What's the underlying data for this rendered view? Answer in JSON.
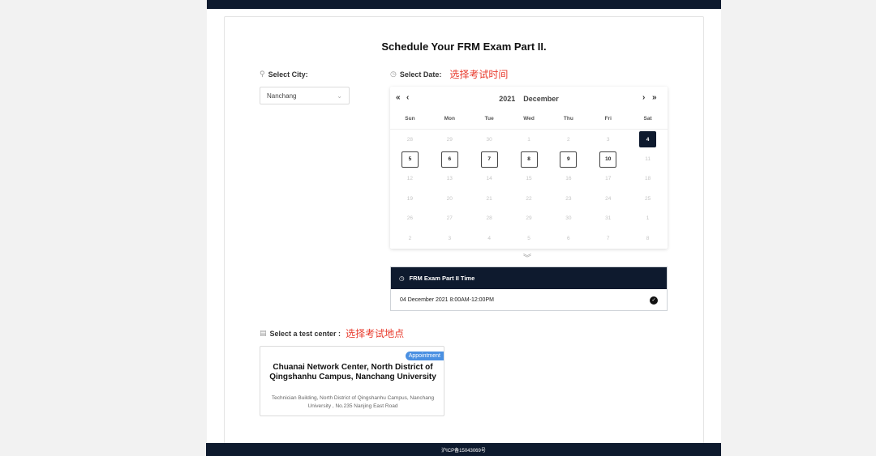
{
  "page": {
    "title": "Schedule Your FRM Exam Part II."
  },
  "city": {
    "label": "Select City:",
    "icon": "location-pin-icon",
    "value": "Nanchang"
  },
  "date": {
    "label": "Select Date:",
    "icon": "clock-icon",
    "annotation": "选择考试时间"
  },
  "calendar": {
    "year": "2021",
    "month": "December",
    "prev_year": "«",
    "prev_month": "‹",
    "next_month": "›",
    "next_year": "»",
    "weekdays": [
      "Sun",
      "Mon",
      "Tue",
      "Wed",
      "Thu",
      "Fri",
      "Sat"
    ],
    "days": [
      {
        "d": "28",
        "s": "muted"
      },
      {
        "d": "29",
        "s": "muted"
      },
      {
        "d": "30",
        "s": "muted"
      },
      {
        "d": "1",
        "s": "muted"
      },
      {
        "d": "2",
        "s": "muted"
      },
      {
        "d": "3",
        "s": "muted"
      },
      {
        "d": "4",
        "s": "selected"
      },
      {
        "d": "5",
        "s": "available"
      },
      {
        "d": "6",
        "s": "available"
      },
      {
        "d": "7",
        "s": "available"
      },
      {
        "d": "8",
        "s": "available"
      },
      {
        "d": "9",
        "s": "available"
      },
      {
        "d": "10",
        "s": "available"
      },
      {
        "d": "11",
        "s": "muted"
      },
      {
        "d": "12",
        "s": "muted"
      },
      {
        "d": "13",
        "s": "muted"
      },
      {
        "d": "14",
        "s": "muted"
      },
      {
        "d": "15",
        "s": "muted"
      },
      {
        "d": "16",
        "s": "muted"
      },
      {
        "d": "17",
        "s": "muted"
      },
      {
        "d": "18",
        "s": "muted"
      },
      {
        "d": "19",
        "s": "muted"
      },
      {
        "d": "20",
        "s": "muted"
      },
      {
        "d": "21",
        "s": "muted"
      },
      {
        "d": "22",
        "s": "muted"
      },
      {
        "d": "23",
        "s": "muted"
      },
      {
        "d": "24",
        "s": "muted"
      },
      {
        "d": "25",
        "s": "muted"
      },
      {
        "d": "26",
        "s": "muted"
      },
      {
        "d": "27",
        "s": "muted"
      },
      {
        "d": "28",
        "s": "muted"
      },
      {
        "d": "29",
        "s": "muted"
      },
      {
        "d": "30",
        "s": "muted"
      },
      {
        "d": "31",
        "s": "muted"
      },
      {
        "d": "1",
        "s": "muted"
      },
      {
        "d": "2",
        "s": "muted"
      },
      {
        "d": "3",
        "s": "muted"
      },
      {
        "d": "4",
        "s": "muted"
      },
      {
        "d": "5",
        "s": "muted"
      },
      {
        "d": "6",
        "s": "muted"
      },
      {
        "d": "7",
        "s": "muted"
      },
      {
        "d": "8",
        "s": "muted"
      }
    ]
  },
  "exam_time": {
    "header": "FRM Exam Part II Time",
    "slot": "04 December 2021 8:00AM-12:00PM",
    "selected": true
  },
  "test_center": {
    "label": "Select a test center :",
    "icon": "document-icon",
    "annotation": "选择考试地点",
    "badge": "Appointment",
    "name": "Chuanai Network Center, North District of Qingshanhu Campus, Nanchang University",
    "address": "Technician Building, North District of Qingshanhu Campus, Nanchang University , No.235 Nanjing East Road"
  },
  "footer": {
    "text": "沪ICP备15043069号"
  },
  "colors": {
    "navy": "#0e1a2e",
    "annotation_red": "#e8392b",
    "badge_blue": "#4a90e2"
  }
}
